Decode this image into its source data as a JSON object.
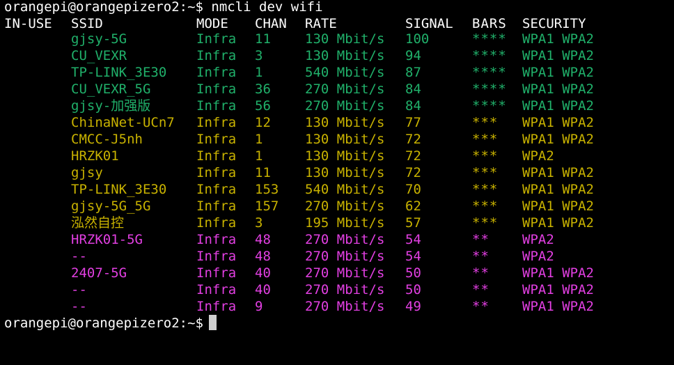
{
  "window": {
    "command_prompt": "orangepi@orangepizero2:~$ nmcli dev wifi",
    "final_prompt": "orangepi@orangepizero2:~$"
  },
  "colors": {
    "background": "#000000",
    "default_text": "#ffffff",
    "signal_strong": "#20b06a",
    "signal_good": "#c8b200",
    "signal_fair": "#e23fe2",
    "cursor": "#cfcfcf"
  },
  "table": {
    "headers": {
      "in_use": "IN-USE",
      "ssid": "SSID",
      "mode": "MODE",
      "chan": "CHAN",
      "rate": "RATE",
      "signal": "SIGNAL",
      "bars": "BARS",
      "security": "SECURITY"
    },
    "rows": [
      {
        "in_use": "",
        "ssid": "gjsy-5G",
        "mode": "Infra",
        "chan": "11",
        "rate": "130 Mbit/s",
        "signal": "100",
        "bars": "****",
        "security": "WPA1 WPA2",
        "group": "strong"
      },
      {
        "in_use": "",
        "ssid": "CU_VEXR",
        "mode": "Infra",
        "chan": "3",
        "rate": "130 Mbit/s",
        "signal": "94",
        "bars": "****",
        "security": "WPA1 WPA2",
        "group": "strong"
      },
      {
        "in_use": "",
        "ssid": "TP-LINK_3E30",
        "mode": "Infra",
        "chan": "1",
        "rate": "540 Mbit/s",
        "signal": "87",
        "bars": "****",
        "security": "WPA1 WPA2",
        "group": "strong"
      },
      {
        "in_use": "",
        "ssid": "CU_VEXR_5G",
        "mode": "Infra",
        "chan": "36",
        "rate": "270 Mbit/s",
        "signal": "84",
        "bars": "****",
        "security": "WPA1 WPA2",
        "group": "strong"
      },
      {
        "in_use": "",
        "ssid": "gjsy-加强版",
        "mode": "Infra",
        "chan": "56",
        "rate": "270 Mbit/s",
        "signal": "84",
        "bars": "****",
        "security": "WPA1 WPA2",
        "group": "strong"
      },
      {
        "in_use": "",
        "ssid": "ChinaNet-UCn7",
        "mode": "Infra",
        "chan": "12",
        "rate": "130 Mbit/s",
        "signal": "77",
        "bars": "***",
        "security": "WPA1 WPA2",
        "group": "good"
      },
      {
        "in_use": "",
        "ssid": "CMCC-J5nh",
        "mode": "Infra",
        "chan": "1",
        "rate": "130 Mbit/s",
        "signal": "72",
        "bars": "***",
        "security": "WPA1 WPA2",
        "group": "good"
      },
      {
        "in_use": "",
        "ssid": "HRZK01",
        "mode": "Infra",
        "chan": "1",
        "rate": "130 Mbit/s",
        "signal": "72",
        "bars": "***",
        "security": "WPA2",
        "group": "good"
      },
      {
        "in_use": "",
        "ssid": "gjsy",
        "mode": "Infra",
        "chan": "11",
        "rate": "130 Mbit/s",
        "signal": "72",
        "bars": "***",
        "security": "WPA1 WPA2",
        "group": "good"
      },
      {
        "in_use": "",
        "ssid": "TP-LINK_3E30",
        "mode": "Infra",
        "chan": "153",
        "rate": "540 Mbit/s",
        "signal": "70",
        "bars": "***",
        "security": "WPA1 WPA2",
        "group": "good"
      },
      {
        "in_use": "",
        "ssid": "gjsy-5G_5G",
        "mode": "Infra",
        "chan": "157",
        "rate": "270 Mbit/s",
        "signal": "62",
        "bars": "***",
        "security": "WPA1 WPA2",
        "group": "good"
      },
      {
        "in_use": "",
        "ssid": "泓然自控",
        "mode": "Infra",
        "chan": "3",
        "rate": "195 Mbit/s",
        "signal": "57",
        "bars": "***",
        "security": "WPA1 WPA2",
        "group": "good"
      },
      {
        "in_use": "",
        "ssid": "HRZK01-5G",
        "mode": "Infra",
        "chan": "48",
        "rate": "270 Mbit/s",
        "signal": "54",
        "bars": "**",
        "security": "WPA2",
        "group": "fair"
      },
      {
        "in_use": "",
        "ssid": "--",
        "mode": "Infra",
        "chan": "48",
        "rate": "270 Mbit/s",
        "signal": "54",
        "bars": "**",
        "security": "WPA2",
        "group": "fair"
      },
      {
        "in_use": "",
        "ssid": "2407-5G",
        "mode": "Infra",
        "chan": "40",
        "rate": "270 Mbit/s",
        "signal": "50",
        "bars": "**",
        "security": "WPA1 WPA2",
        "group": "fair"
      },
      {
        "in_use": "",
        "ssid": "--",
        "mode": "Infra",
        "chan": "40",
        "rate": "270 Mbit/s",
        "signal": "50",
        "bars": "**",
        "security": "WPA1 WPA2",
        "group": "fair"
      },
      {
        "in_use": "",
        "ssid": "--",
        "mode": "Infra",
        "chan": "9",
        "rate": "270 Mbit/s",
        "signal": "49",
        "bars": "**",
        "security": "WPA1 WPA2",
        "group": "fair"
      }
    ]
  }
}
